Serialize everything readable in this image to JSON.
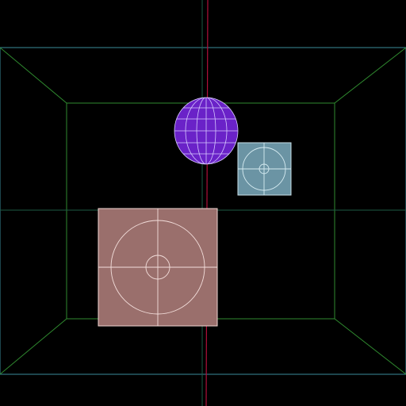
{
  "viewport": {
    "background_color": "#000000"
  },
  "room": {
    "outer_edge_color": "#3a8c9a",
    "inner_edge_color": "#2f8a2f",
    "mid_line_color": "#1d5a44"
  },
  "axis": {
    "color": "#b0103a"
  },
  "sphere": {
    "fill_color": "#6a22c8",
    "grid_color": "#d7c9ff",
    "icon": "sphere-icon"
  },
  "small_panel": {
    "fill_color": "#6b94a4",
    "edge_color": "#c8e0e8",
    "target_color": "#d6ecf2",
    "icon": "target-icon"
  },
  "large_panel": {
    "fill_color": "#9a6f6c",
    "edge_color": "#f0d6d2",
    "target_color": "#f3dedb",
    "icon": "target-icon"
  }
}
